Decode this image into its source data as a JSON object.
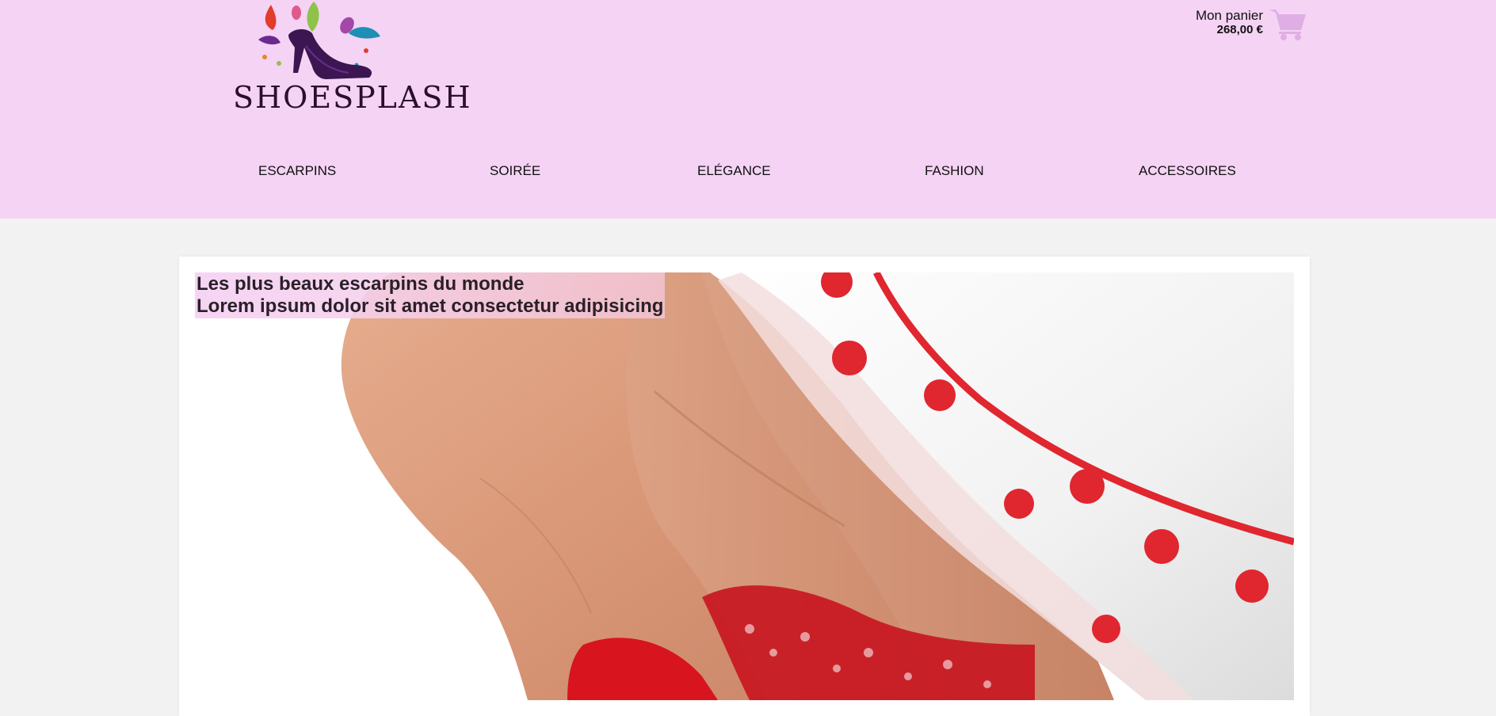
{
  "brand": {
    "name": "SHOESPLASH",
    "logo_icon": "high-heel-splash-logo"
  },
  "cart": {
    "label": "Mon panier",
    "total": "268,00 €",
    "icon": "cart-icon"
  },
  "nav": {
    "items": [
      {
        "label": "ESCARPINS"
      },
      {
        "label": "SOIRÉE"
      },
      {
        "label": "ELÉGANCE"
      },
      {
        "label": "FASHION"
      },
      {
        "label": "ACCESSOIRES"
      }
    ]
  },
  "hero": {
    "line1": "Les plus beaux escarpins du monde",
    "line2": "Lorem ipsum dolor sit amet consectetur adipisicing",
    "image": "legs-red-heels-polka-dot-skirt-photo"
  },
  "colors": {
    "header_bg": "#f5d3f4",
    "page_bg": "#f2f2f2",
    "cart_icon": "#dfaee4",
    "logo_shoe": "#3c1651"
  }
}
